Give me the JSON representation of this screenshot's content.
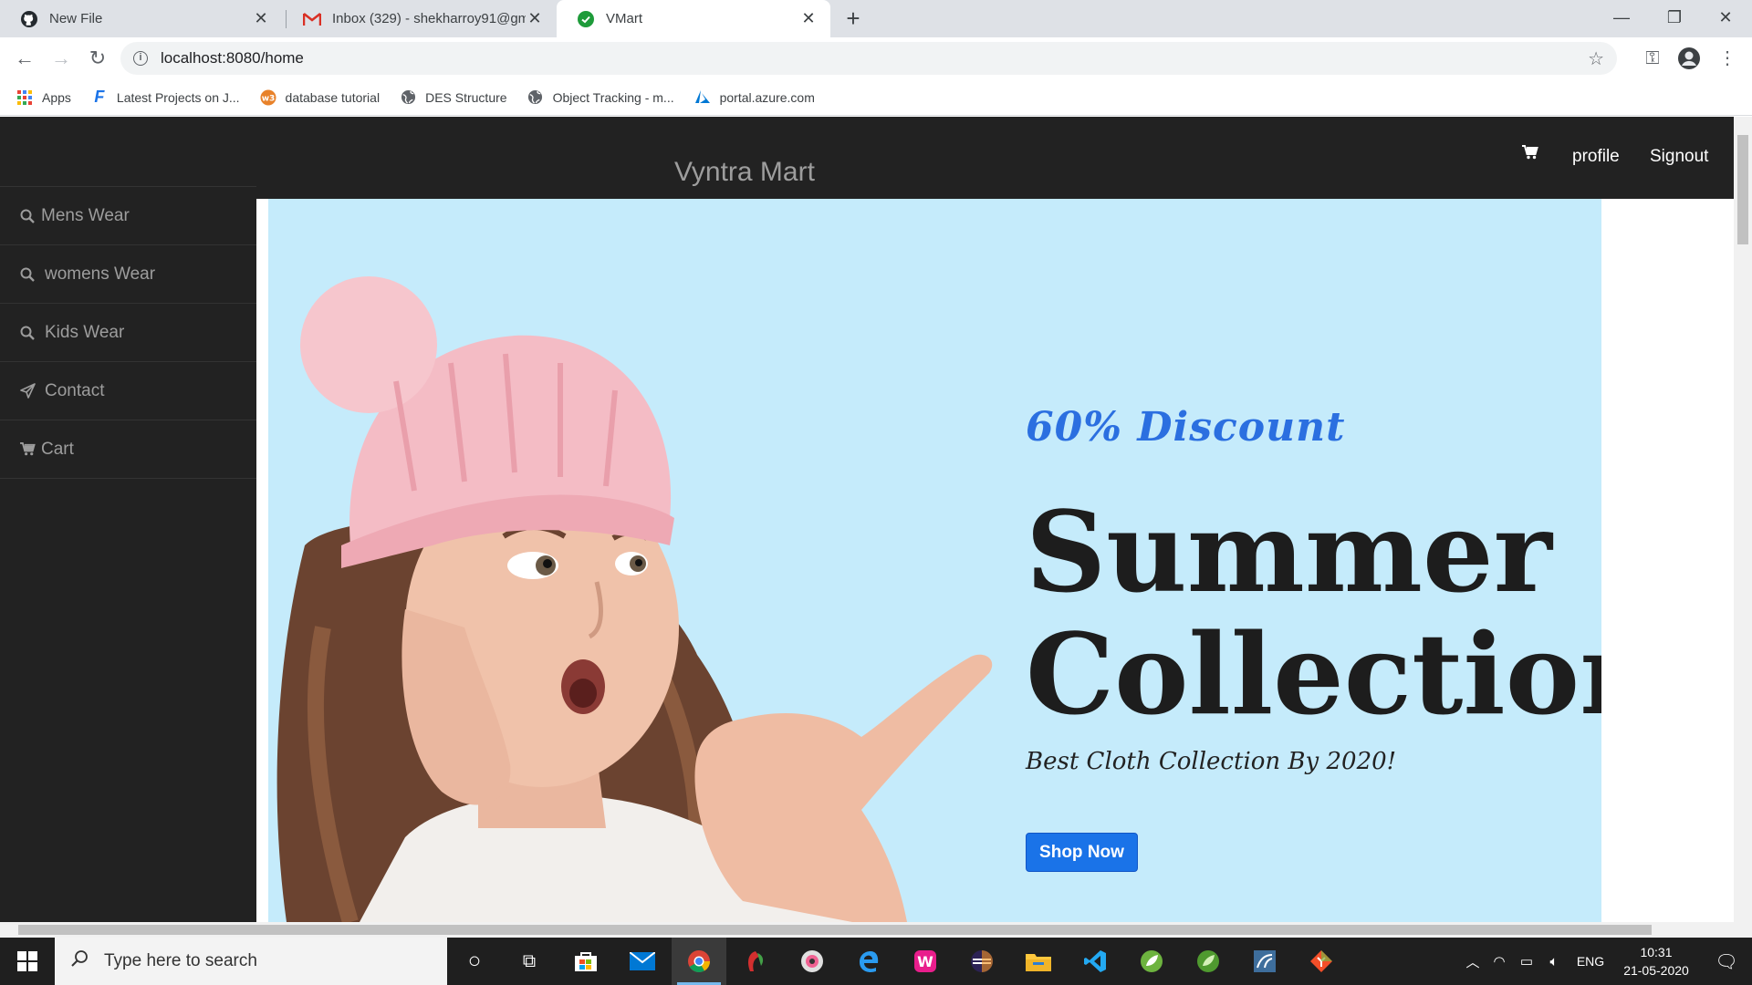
{
  "browser": {
    "tabs": [
      {
        "title": "New File",
        "icon": "github-icon"
      },
      {
        "title": "Inbox (329) - shekharroy91@gm...",
        "icon": "gmail-icon"
      },
      {
        "title": "VMart",
        "icon": "check-circle-icon"
      }
    ],
    "url": "localhost:8080/home",
    "bookmarks": [
      {
        "label": "Apps",
        "icon": "apps-grid-icon"
      },
      {
        "label": "Latest Projects on J...",
        "icon": "f-logo-icon"
      },
      {
        "label": "database tutorial",
        "icon": "w3-icon"
      },
      {
        "label": "DES Structure",
        "icon": "globe-icon"
      },
      {
        "label": "Object Tracking - m...",
        "icon": "globe-icon"
      },
      {
        "label": "portal.azure.com",
        "icon": "azure-icon"
      }
    ]
  },
  "site": {
    "brand": "Vyntra Mart",
    "nav": {
      "profile": "profile",
      "signout": "Signout"
    },
    "sidebar": [
      {
        "label": "Mens Wear",
        "icon": "search-icon"
      },
      {
        "label": "womens Wear",
        "icon": "search-icon"
      },
      {
        "label": "Kids Wear",
        "icon": "search-icon"
      },
      {
        "label": "Contact",
        "icon": "send-icon"
      },
      {
        "label": "Cart",
        "icon": "cart-icon"
      }
    ],
    "hero": {
      "discount": "60% Discount",
      "headline_line1": "Summer",
      "headline_line2": "Collection",
      "subline": "Best Cloth Collection By 2020!",
      "button": "Shop Now"
    }
  },
  "taskbar": {
    "search_placeholder": "Type here to search",
    "language": "ENG",
    "time": "10:31",
    "date": "21-05-2020"
  },
  "colors": {
    "navbar": "#222222",
    "hero_bg": "#c5ebfb",
    "accent_blue": "#1a73e8",
    "discount_blue": "#2b6fe0"
  }
}
